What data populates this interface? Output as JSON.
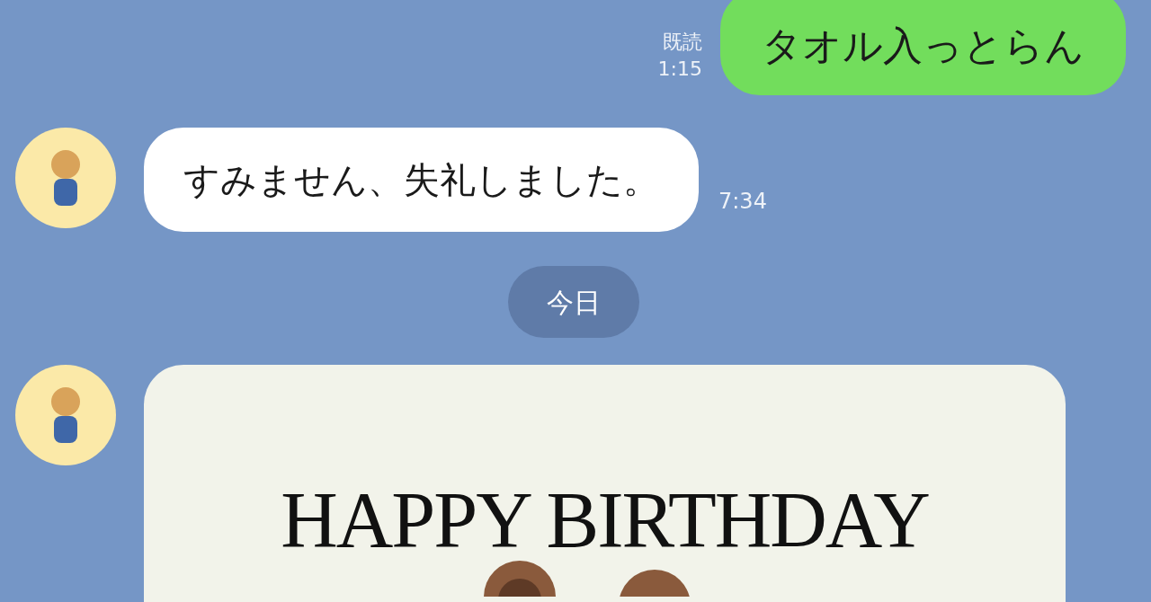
{
  "messages": [
    {
      "kind": "sent",
      "text": "タオル入っとらん",
      "read_label": "既読",
      "time": "1:15"
    },
    {
      "kind": "received",
      "text": "すみません、失礼しました。",
      "time": "7:34"
    },
    {
      "kind": "date",
      "text": "今日"
    },
    {
      "kind": "card",
      "text": "HAPPY BIRTHDAY"
    }
  ]
}
